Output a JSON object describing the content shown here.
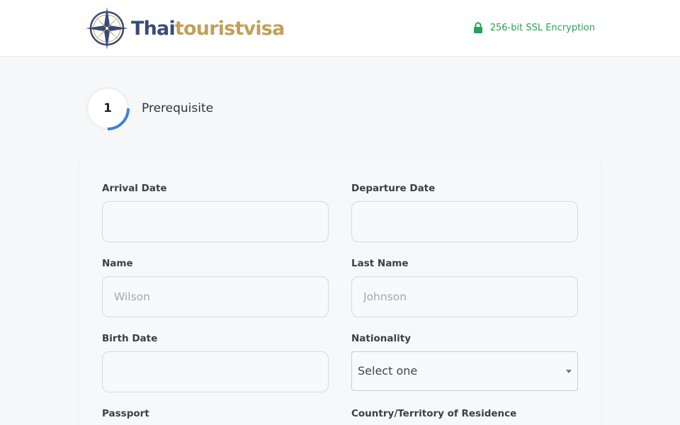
{
  "header": {
    "logo_text_part1": "Thai",
    "logo_text_part2": "touristvisa",
    "ssl_text": "256-bit SSL Encryption",
    "accent_green": "#2aa05a"
  },
  "step": {
    "number": "1",
    "label": "Prerequisite",
    "ring_color": "#3d7fe0"
  },
  "form": {
    "arrival_date": {
      "label": "Arrival Date",
      "value": "",
      "placeholder": ""
    },
    "departure_date": {
      "label": "Departure Date",
      "value": "",
      "placeholder": ""
    },
    "name": {
      "label": "Name",
      "value": "",
      "placeholder": "Wilson"
    },
    "last_name": {
      "label": "Last Name",
      "value": "",
      "placeholder": "Johnson"
    },
    "birth_date": {
      "label": "Birth Date",
      "value": "",
      "placeholder": ""
    },
    "nationality": {
      "label": "Nationality",
      "selected": "Select one"
    },
    "passport": {
      "label": "Passport"
    },
    "residence": {
      "label": "Country/Territory of Residence"
    }
  }
}
